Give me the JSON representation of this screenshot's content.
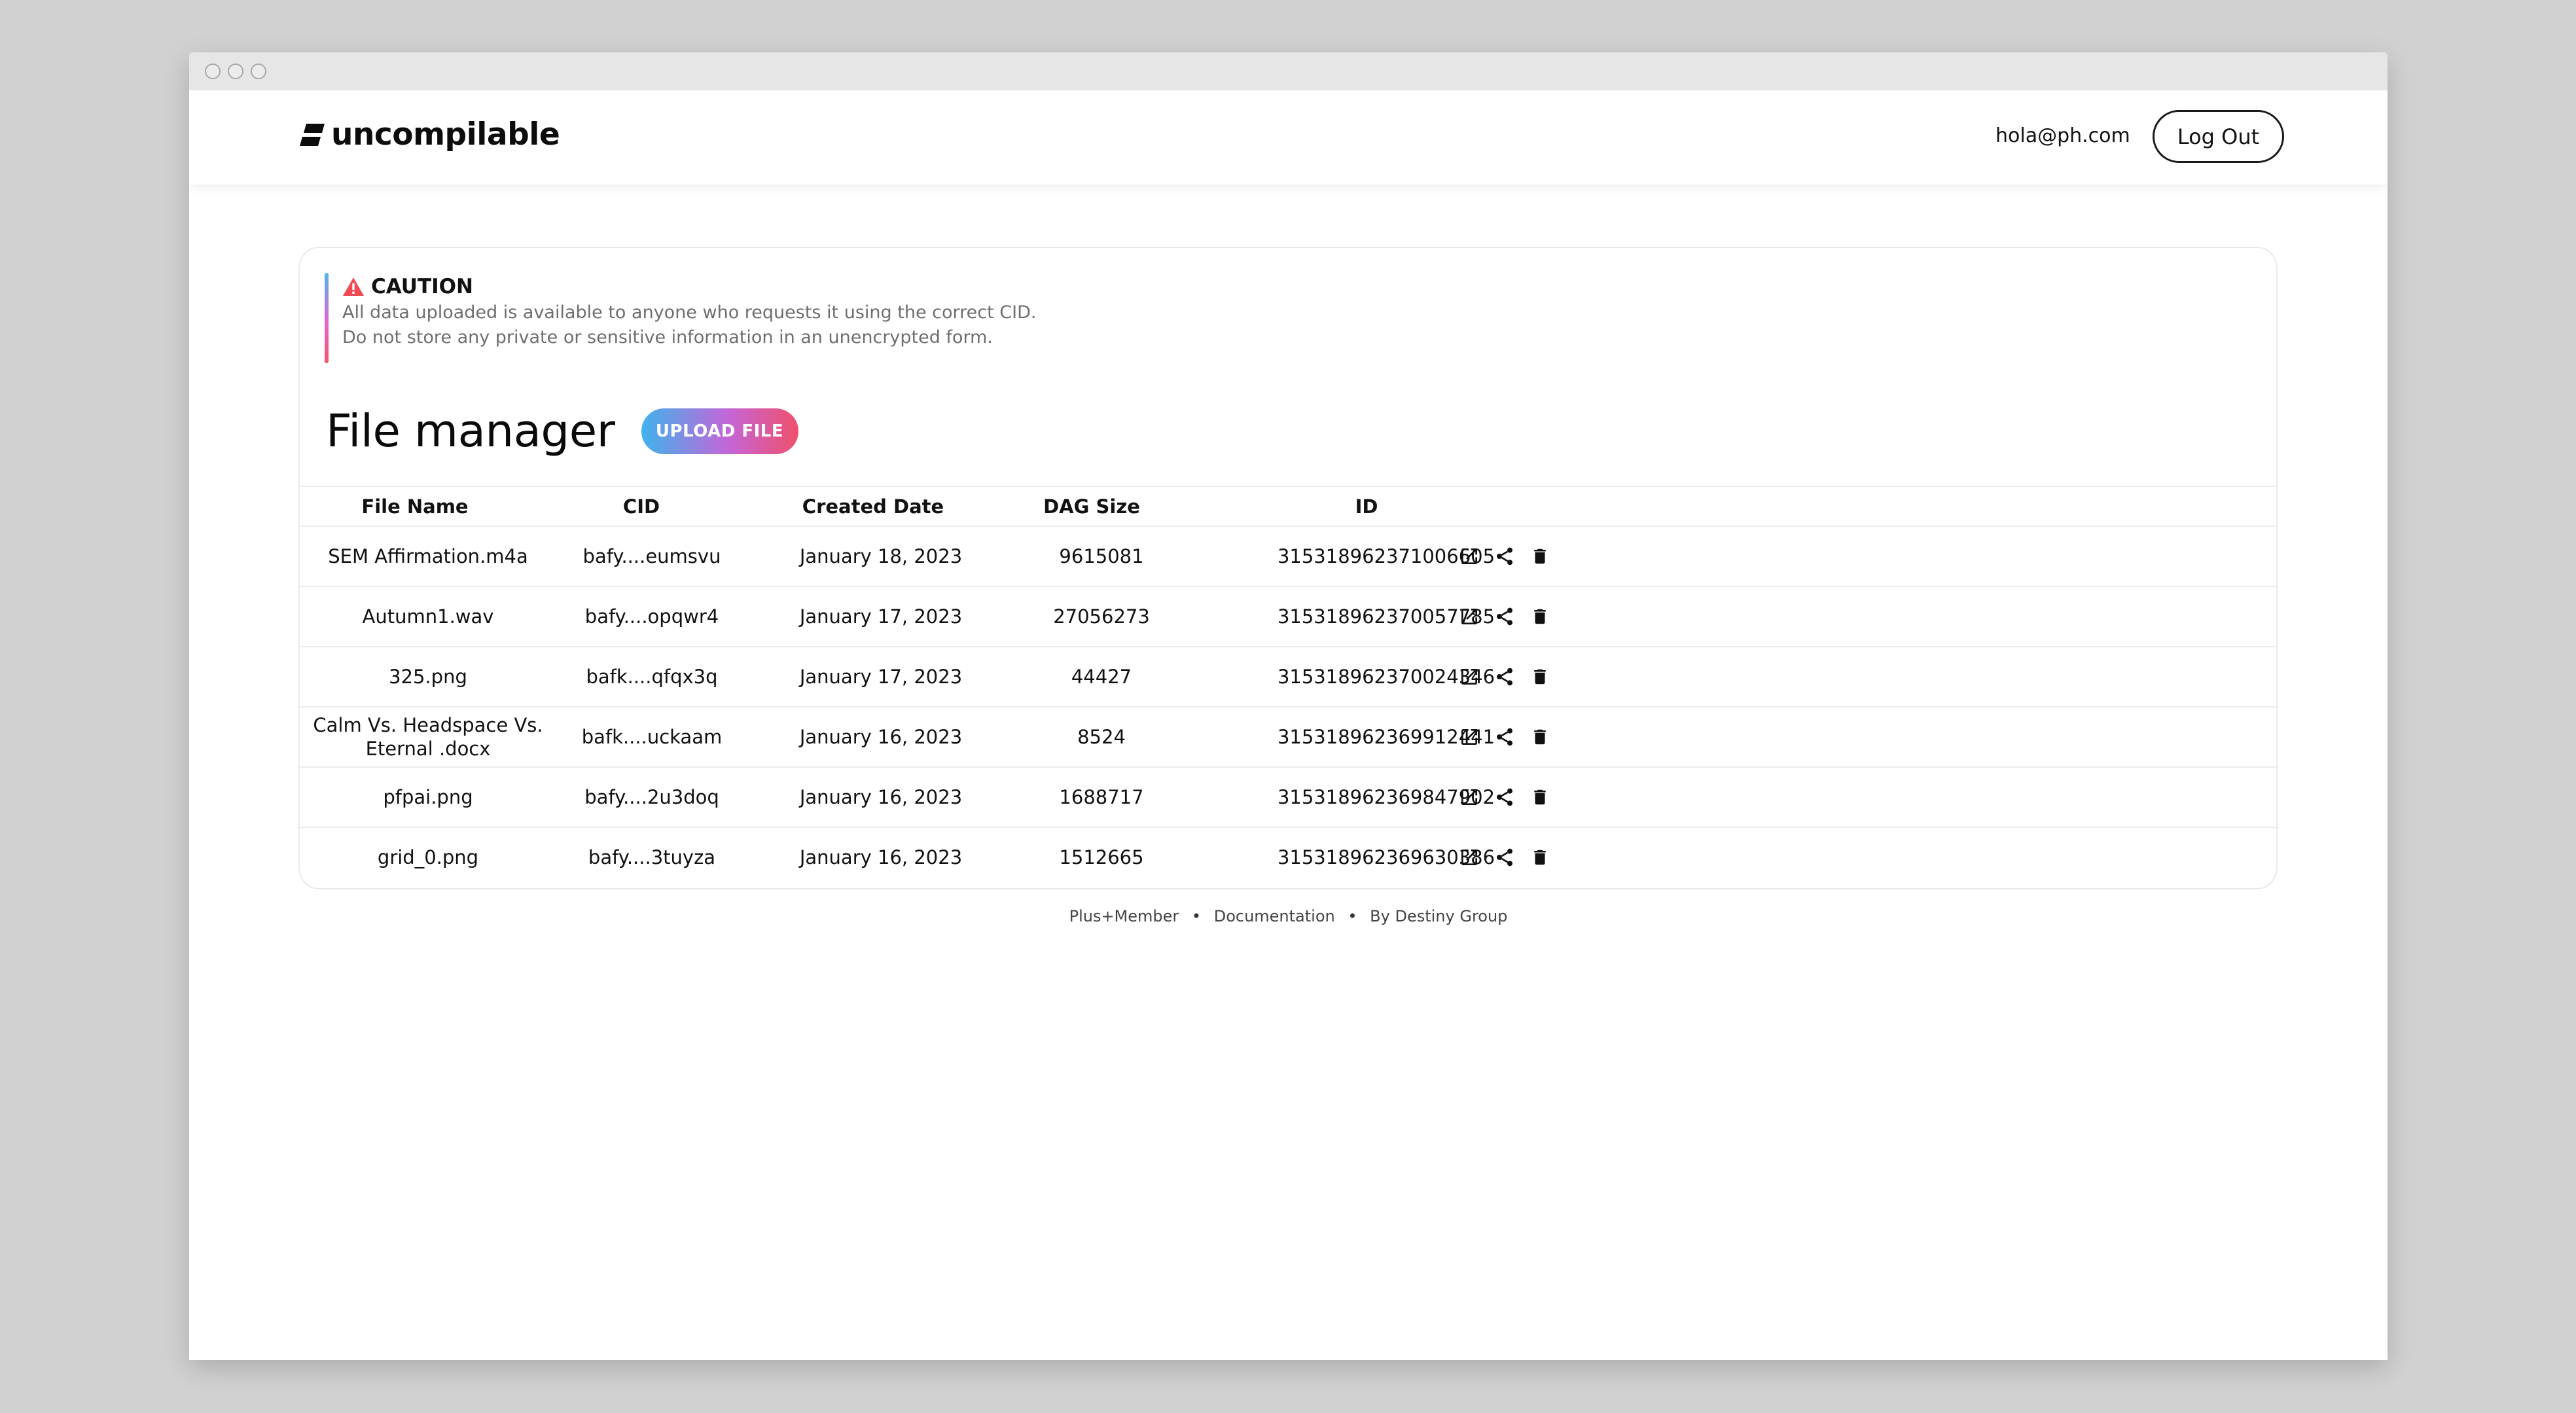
{
  "brand": {
    "name": "uncompilable"
  },
  "header": {
    "email": "hola@ph.com",
    "logout_label": "Log Out"
  },
  "caution": {
    "title": "CAUTION",
    "line1": "All data uploaded is available to anyone who requests it using the correct CID.",
    "line2": "Do not store any private or sensitive information in an unencrypted form."
  },
  "main": {
    "title": "File manager",
    "upload_label": "UPLOAD FILE"
  },
  "table": {
    "columns": [
      "File Name",
      "CID",
      "Created Date",
      "DAG Size",
      "ID"
    ],
    "rows": [
      {
        "name": "SEM Affirmation.m4a",
        "cid": "bafy....eumsvu",
        "date": "January 18, 2023",
        "dag": "9615081",
        "id": "315318962371006605"
      },
      {
        "name": "Autumn1.wav",
        "cid": "bafy....opqwr4",
        "date": "January 17, 2023",
        "dag": "27056273",
        "id": "315318962370057785"
      },
      {
        "name": "325.png",
        "cid": "bafk....qfqx3q",
        "date": "January 17, 2023",
        "dag": "44427",
        "id": "315318962370024346"
      },
      {
        "name": "Calm Vs. Headspace Vs. Eternal .docx",
        "cid": "bafk....uckaam",
        "date": "January 16, 2023",
        "dag": "8524",
        "id": "315318962369912441"
      },
      {
        "name": "pfpai.png",
        "cid": "bafy....2u3doq",
        "date": "January 16, 2023",
        "dag": "1688717",
        "id": "315318962369847902"
      },
      {
        "name": "grid_0.png",
        "cid": "bafy....3tuyza",
        "date": "January 16, 2023",
        "dag": "1512665",
        "id": "315318962369630386"
      }
    ],
    "row_actions": [
      "external-link-icon",
      "share-icon",
      "trash-icon"
    ]
  },
  "footer": {
    "link1": "Plus+Member",
    "link2": "Documentation",
    "link3": "By Destiny Group",
    "separator": "•"
  },
  "colors": {
    "accent_start": "#3fb3ec",
    "accent_mid": "#c366d8",
    "accent_end": "#f0506c",
    "caution_icon": "#f04a55"
  }
}
